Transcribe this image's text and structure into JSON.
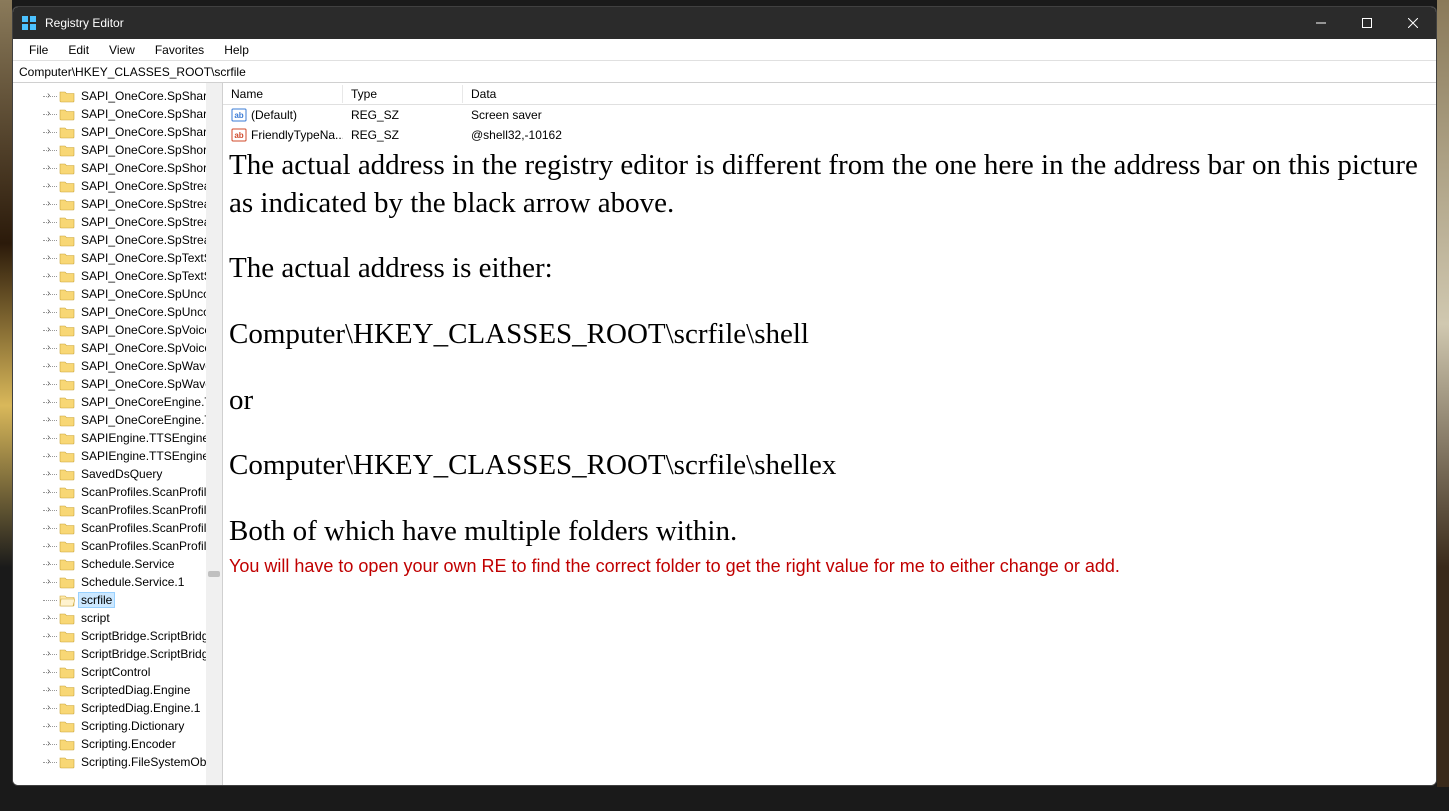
{
  "window": {
    "title": "Registry Editor"
  },
  "menu": {
    "file": "File",
    "edit": "Edit",
    "view": "View",
    "favorites": "Favorites",
    "help": "Help"
  },
  "address": "Computer\\HKEY_CLASSES_ROOT\\scrfile",
  "treeItems": [
    "SAPI_OneCore.SpShare…",
    "SAPI_OneCore.SpShare…",
    "SAPI_OneCore.SpShare…",
    "SAPI_OneCore.SpShortc…",
    "SAPI_OneCore.SpShortc…",
    "SAPI_OneCore.SpStrear…",
    "SAPI_OneCore.SpStrear…",
    "SAPI_OneCore.SpStrear…",
    "SAPI_OneCore.SpStrear…",
    "SAPI_OneCore.SpTextSe…",
    "SAPI_OneCore.SpTextSe…",
    "SAPI_OneCore.SpUncor…",
    "SAPI_OneCore.SpUncor…",
    "SAPI_OneCore.SpVoice",
    "SAPI_OneCore.SpVoice.…",
    "SAPI_OneCore.SpWavel…",
    "SAPI_OneCore.SpWavel…",
    "SAPI_OneCoreEngine.T…",
    "SAPI_OneCoreEngine.T…",
    "SAPIEngine.TTSEngine",
    "SAPIEngine.TTSEngine.…",
    "SavedDsQuery",
    "ScanProfiles.ScanProfile…",
    "ScanProfiles.ScanProfile…",
    "ScanProfiles.ScanProfile…",
    "ScanProfiles.ScanProfile…",
    "Schedule.Service",
    "Schedule.Service.1",
    "scrfile",
    "script",
    "ScriptBridge.ScriptBridg…",
    "ScriptBridge.ScriptBridg…",
    "ScriptControl",
    "ScriptedDiag.Engine",
    "ScriptedDiag.Engine.1",
    "Scripting.Dictionary",
    "Scripting.Encoder",
    "Scripting.FileSystemOb…"
  ],
  "selectedIndex": 28,
  "columns": {
    "name": "Name",
    "type": "Type",
    "data": "Data"
  },
  "values": [
    {
      "name": "(Default)",
      "type": "REG_SZ",
      "data": "Screen saver",
      "iconColor": "#3a7bd5"
    },
    {
      "name": "FriendlyTypeNa...",
      "type": "REG_SZ",
      "data": "@shell32,-10162",
      "iconColor": "#d04a2a"
    }
  ],
  "overlay": {
    "p1": "The actual address in the registry editor is different from the one here in the address bar on this picture as indicated by the black arrow above.",
    "p2": "The actual address is either:",
    "p3": "Computer\\HKEY_CLASSES_ROOT\\scrfile\\shell",
    "p4": "or",
    "p5": "Computer\\HKEY_CLASSES_ROOT\\scrfile\\shellex",
    "p6": "Both of which have multiple folders within.",
    "p7": "You will have to open your own RE to find the correct folder to get the right value for me to either change or add."
  }
}
